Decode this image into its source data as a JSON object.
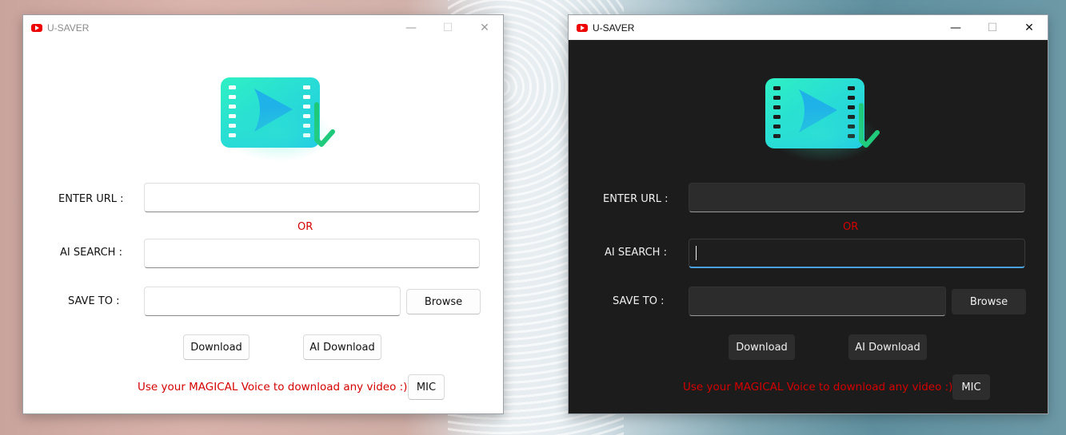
{
  "light_window": {
    "title": "U-SAVER",
    "controls": {
      "minimize": "—",
      "maximize": "☐",
      "close": "✕"
    },
    "url_label": "ENTER URL :",
    "url_value": "",
    "or_text": "OR",
    "ai_search_label": "AI SEARCH :",
    "ai_search_value": "",
    "save_to_label": "SAVE TO :",
    "save_to_value": "",
    "browse_label": "Browse",
    "download_label": "Download",
    "ai_download_label": "AI Download",
    "voice_text": "Use your MAGICAL Voice to download any video :)",
    "mic_label": "MIC"
  },
  "dark_window": {
    "title": "U-SAVER",
    "controls": {
      "minimize": "—",
      "maximize": "☐",
      "close": "✕"
    },
    "url_label": "ENTER URL :",
    "url_value": "",
    "or_text": "OR",
    "ai_search_label": "AI SEARCH :",
    "ai_search_value": "",
    "save_to_label": "SAVE TO :",
    "save_to_value": "",
    "browse_label": "Browse",
    "download_label": "Download",
    "ai_download_label": "AI Download",
    "voice_text": "Use your MAGICAL Voice to download any video :)",
    "mic_label": "MIC"
  },
  "icons": {
    "app": "youtube-play-icon",
    "logo": "video-download-logo-icon"
  },
  "colors": {
    "accent_red": "#d40000",
    "logo_teal": "#2de0c8",
    "logo_cyan": "#22bfe0",
    "check_green": "#1fc97a",
    "focus_blue": "#4aa3e0"
  }
}
